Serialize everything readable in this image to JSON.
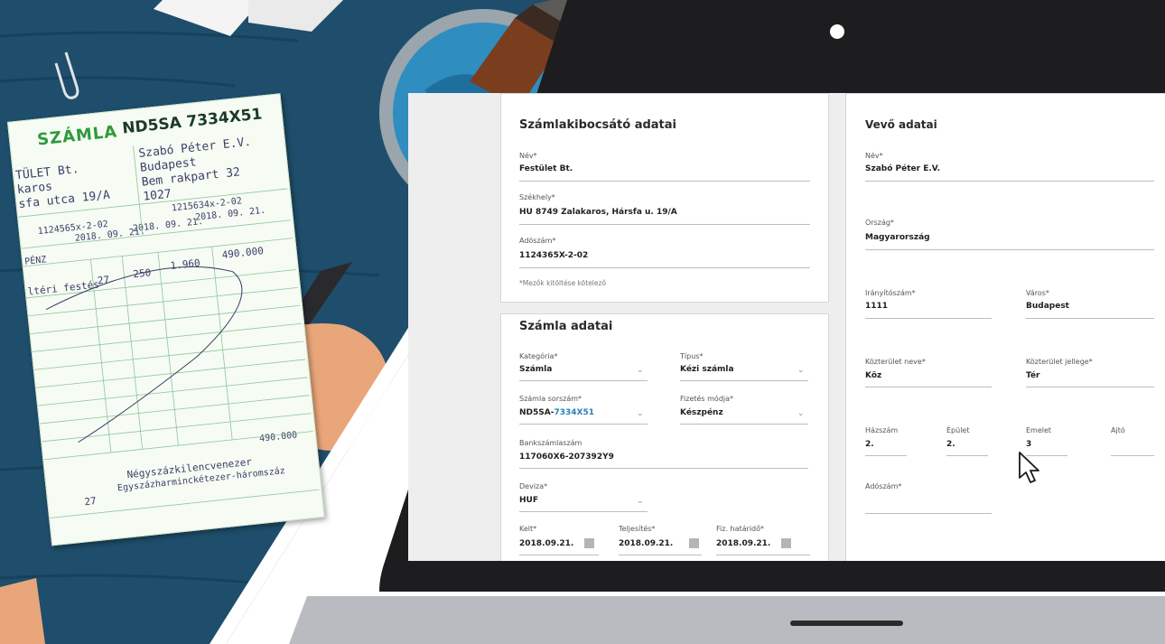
{
  "paper_invoice": {
    "title": "SZÁMLA",
    "serial_prefix": "ND5SA",
    "serial_number": "7334X51",
    "seller_name": "TÜLET Bt.",
    "seller_city": "karos",
    "seller_street": "sfa utca 19/A",
    "buyer_name": "Szabó Péter E.V.",
    "buyer_city": "Budapest",
    "buyer_street": "Bem rakpart 32",
    "buyer_zip": "1027",
    "seller_tax": "1124565x-2-02",
    "buyer_tax": "1215634x-2-02",
    "date1": "2018. 09. 21.",
    "date2": "2018. 09. 21.",
    "date3": "2018. 09. 21.",
    "payment": "PÉNZ",
    "item": "ltéri festés",
    "qty": "27",
    "unit_price": "250",
    "net": "1.960",
    "gross": "490.000",
    "total": "490.000",
    "words_line1": "Négyszázkilencvenezer",
    "words_line2": "Egyszázharminckétezer-háromszáz",
    "footer_num": "27"
  },
  "seller_section": {
    "title": "Számlakibocsátó adatai",
    "name_label": "Név*",
    "name_value": "Festület Bt.",
    "address_label": "Székhely*",
    "address_value": "HU 8749 Zalakaros, Hársfa u. 19/A",
    "tax_label": "Adószám*",
    "tax_value": "1124365X-2-02",
    "required_note": "*Mezők kitöltése kötelező"
  },
  "invoice_section": {
    "title": "Számla adatai",
    "category_label": "Kategória*",
    "category_value": "Számla",
    "type_label": "Típus*",
    "type_value": "Kézi számla",
    "number_label": "Számla sorszám*",
    "number_prefix": "ND5SA-",
    "number_suffix": "7334X51",
    "payment_label": "Fizetés módja*",
    "payment_value": "Készpénz",
    "bank_label": "Bankszámlaszám",
    "bank_value": "117060X6-207392Y9",
    "currency_label": "Deviza*",
    "currency_value": "HUF",
    "issued_label": "Kelt*",
    "issued_value": "2018.09.21.",
    "completion_label": "Teljesítés*",
    "completion_value": "2018.09.21.",
    "due_label": "Fiz. határidő*",
    "due_value": "2018.09.21."
  },
  "buyer_section": {
    "title": "Vevő adatai",
    "name_label": "Név*",
    "name_value": "Szabó Péter E.V.",
    "country_label": "Ország*",
    "country_value": "Magyarország",
    "zip_label": "Irányítószám*",
    "zip_value": "1111",
    "city_label": "Város*",
    "city_value": "Budapest",
    "street_label": "Közterület neve*",
    "street_value": "Köz",
    "street_type_label": "Közterület jellege*",
    "street_type_value": "Tér",
    "house_label": "Házszám",
    "house_value": "2.",
    "building_label": "Épület",
    "building_value": "2.",
    "floor_label": "Emelet",
    "floor_value": "3",
    "door_label": "Ajtó",
    "door_value": "",
    "tax_label": "Adószám*",
    "tax_value": ""
  },
  "colors": {
    "desk": "#1e4e6b",
    "paper_green": "#2e9a3c",
    "laptop_bezel": "#1d1d1f",
    "laptop_body": "#bfc3c7",
    "invoice_link": "#2a7fb8"
  },
  "icons": {
    "cursor": "mouse-pointer-icon",
    "dropdown": "chevron-down-icon",
    "calendar": "calendar-icon"
  }
}
